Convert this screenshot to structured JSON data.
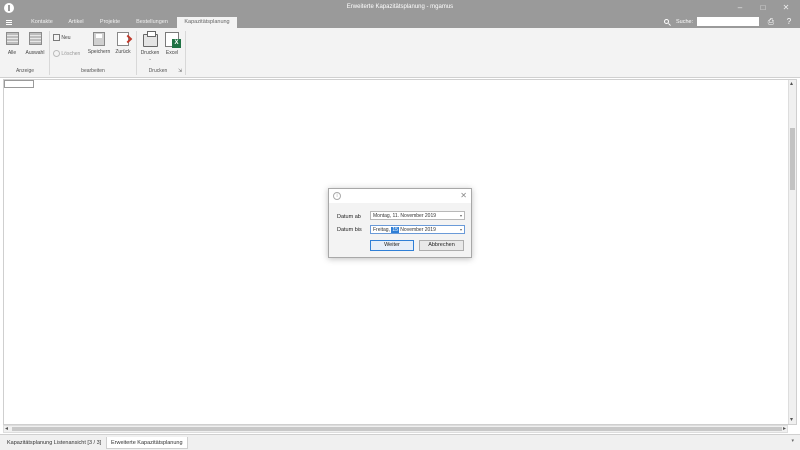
{
  "window": {
    "title": "Erweiterte Kapazitätsplanung - mgamus"
  },
  "tabs": [
    {
      "label": "Kontakte"
    },
    {
      "label": "Artikel"
    },
    {
      "label": "Projekte"
    },
    {
      "label": "Bestellungen"
    },
    {
      "label": "Kapazitätsplanung"
    }
  ],
  "search": {
    "label": "Suche:",
    "value": ""
  },
  "ribbon": {
    "alle": "Alle",
    "auswahl": "Auswahl",
    "neu": "Neu",
    "loeschen": "Löschen",
    "speichern": "Speichern",
    "zurueck": "Zurück",
    "drucken": "Drucken",
    "excel": "Excel",
    "group_anzeige": "Anzeige",
    "group_bearbeiten": "bearbeiten",
    "group_drucken": "Drucken"
  },
  "bottom_tabs": [
    {
      "label": "Kapazitätsplanung Listenansicht [3 / 3]"
    },
    {
      "label": "Erweiterte Kapazitätsplanung"
    }
  ],
  "dialog": {
    "datum_ab_label": "Datum ab",
    "datum_ab_value": "Montag, 11. November 2019",
    "datum_bis_label": "Datum bis",
    "datum_bis_prefix": "Freitag,",
    "datum_bis_day": "15",
    "datum_bis_suffix": "November 2019",
    "weiter": "Weiter",
    "abbrechen": "Abbrechen"
  }
}
